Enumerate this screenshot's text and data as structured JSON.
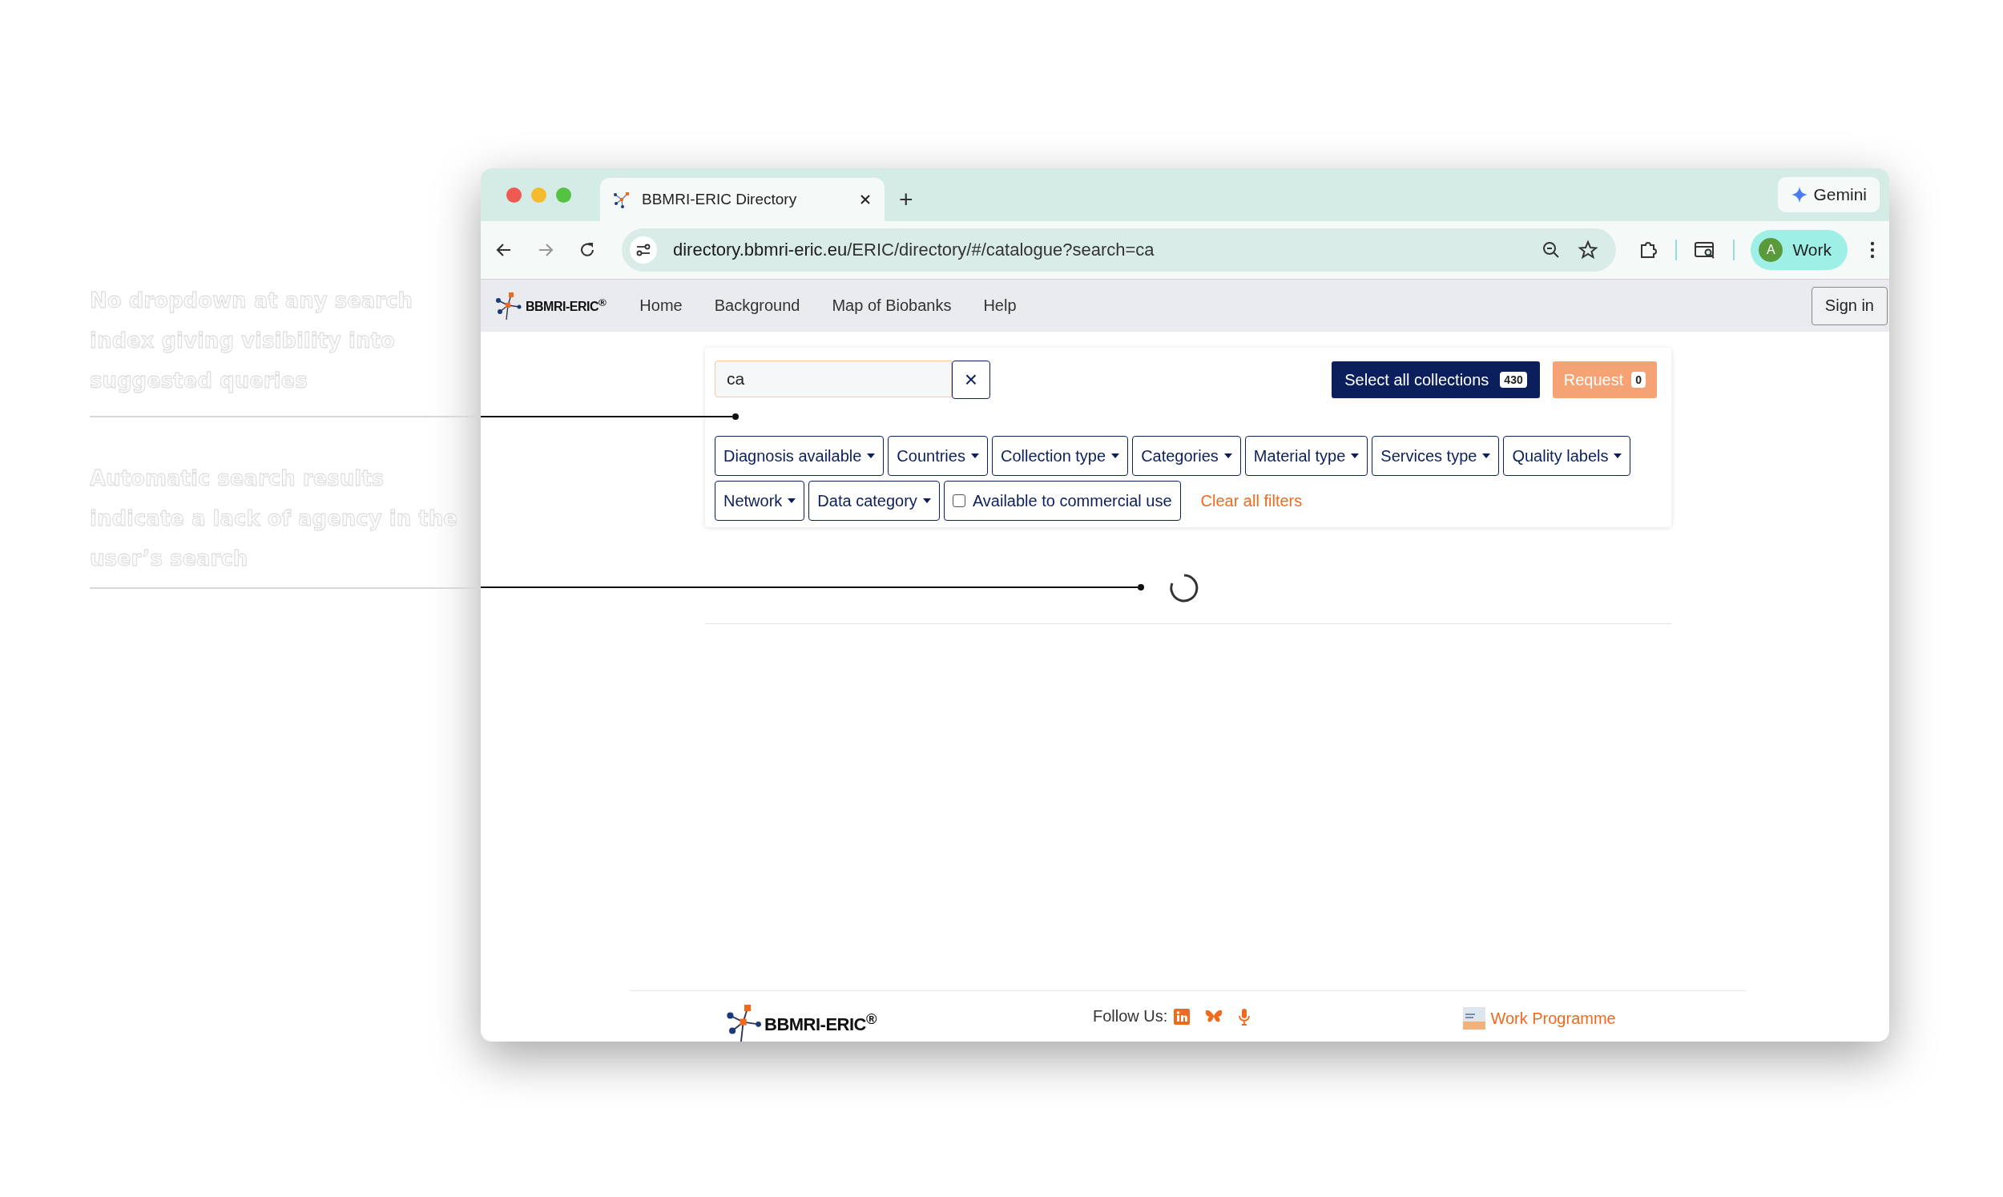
{
  "annotations": [
    {
      "text": "No dropdown at any search index giving visibility into suggested queries"
    },
    {
      "text": "Automatic search results indicate a lack of agency in the user’s search"
    }
  ],
  "browser": {
    "tab_title": "BBMRI-ERIC Directory",
    "new_tab": "+",
    "gemini": "Gemini",
    "url_host": "directory.bbmri-eric.eu",
    "url_path": "/ERIC/directory/#/catalogue?search=ca",
    "profile_initial": "A",
    "profile_name": "Work"
  },
  "site": {
    "logo": "BBMRI-ERIC$^{®}$",
    "nav": [
      "Home",
      "Background",
      "Map of Biobanks",
      "Help"
    ],
    "sign_in": "Sign in"
  },
  "search": {
    "value": "ca",
    "clear": "×"
  },
  "select_all": {
    "label": "Select all collections",
    "count": "430"
  },
  "request": {
    "label": "Request",
    "count": "0",
    "disabled": true
  },
  "filters": [
    {
      "label": "Diagnosis available",
      "kind": "dropdown"
    },
    {
      "label": "Countries",
      "kind": "dropdown"
    },
    {
      "label": "Collection type",
      "kind": "dropdown"
    },
    {
      "label": "Categories",
      "kind": "dropdown"
    },
    {
      "label": "Material type",
      "kind": "dropdown"
    },
    {
      "label": "Services type",
      "kind": "dropdown"
    },
    {
      "label": "Quality labels",
      "kind": "dropdown"
    },
    {
      "label": "Network",
      "kind": "dropdown"
    },
    {
      "label": "Data category",
      "kind": "dropdown"
    },
    {
      "label": "Available to commercial use",
      "kind": "checkbox",
      "checked": false
    }
  ],
  "clear_filters": "Clear all filters",
  "loading": true,
  "footer": {
    "logo": "BBMRI-ERIC$^{®}$",
    "follow": "Follow Us:",
    "work_programme": "Work Programme"
  }
}
